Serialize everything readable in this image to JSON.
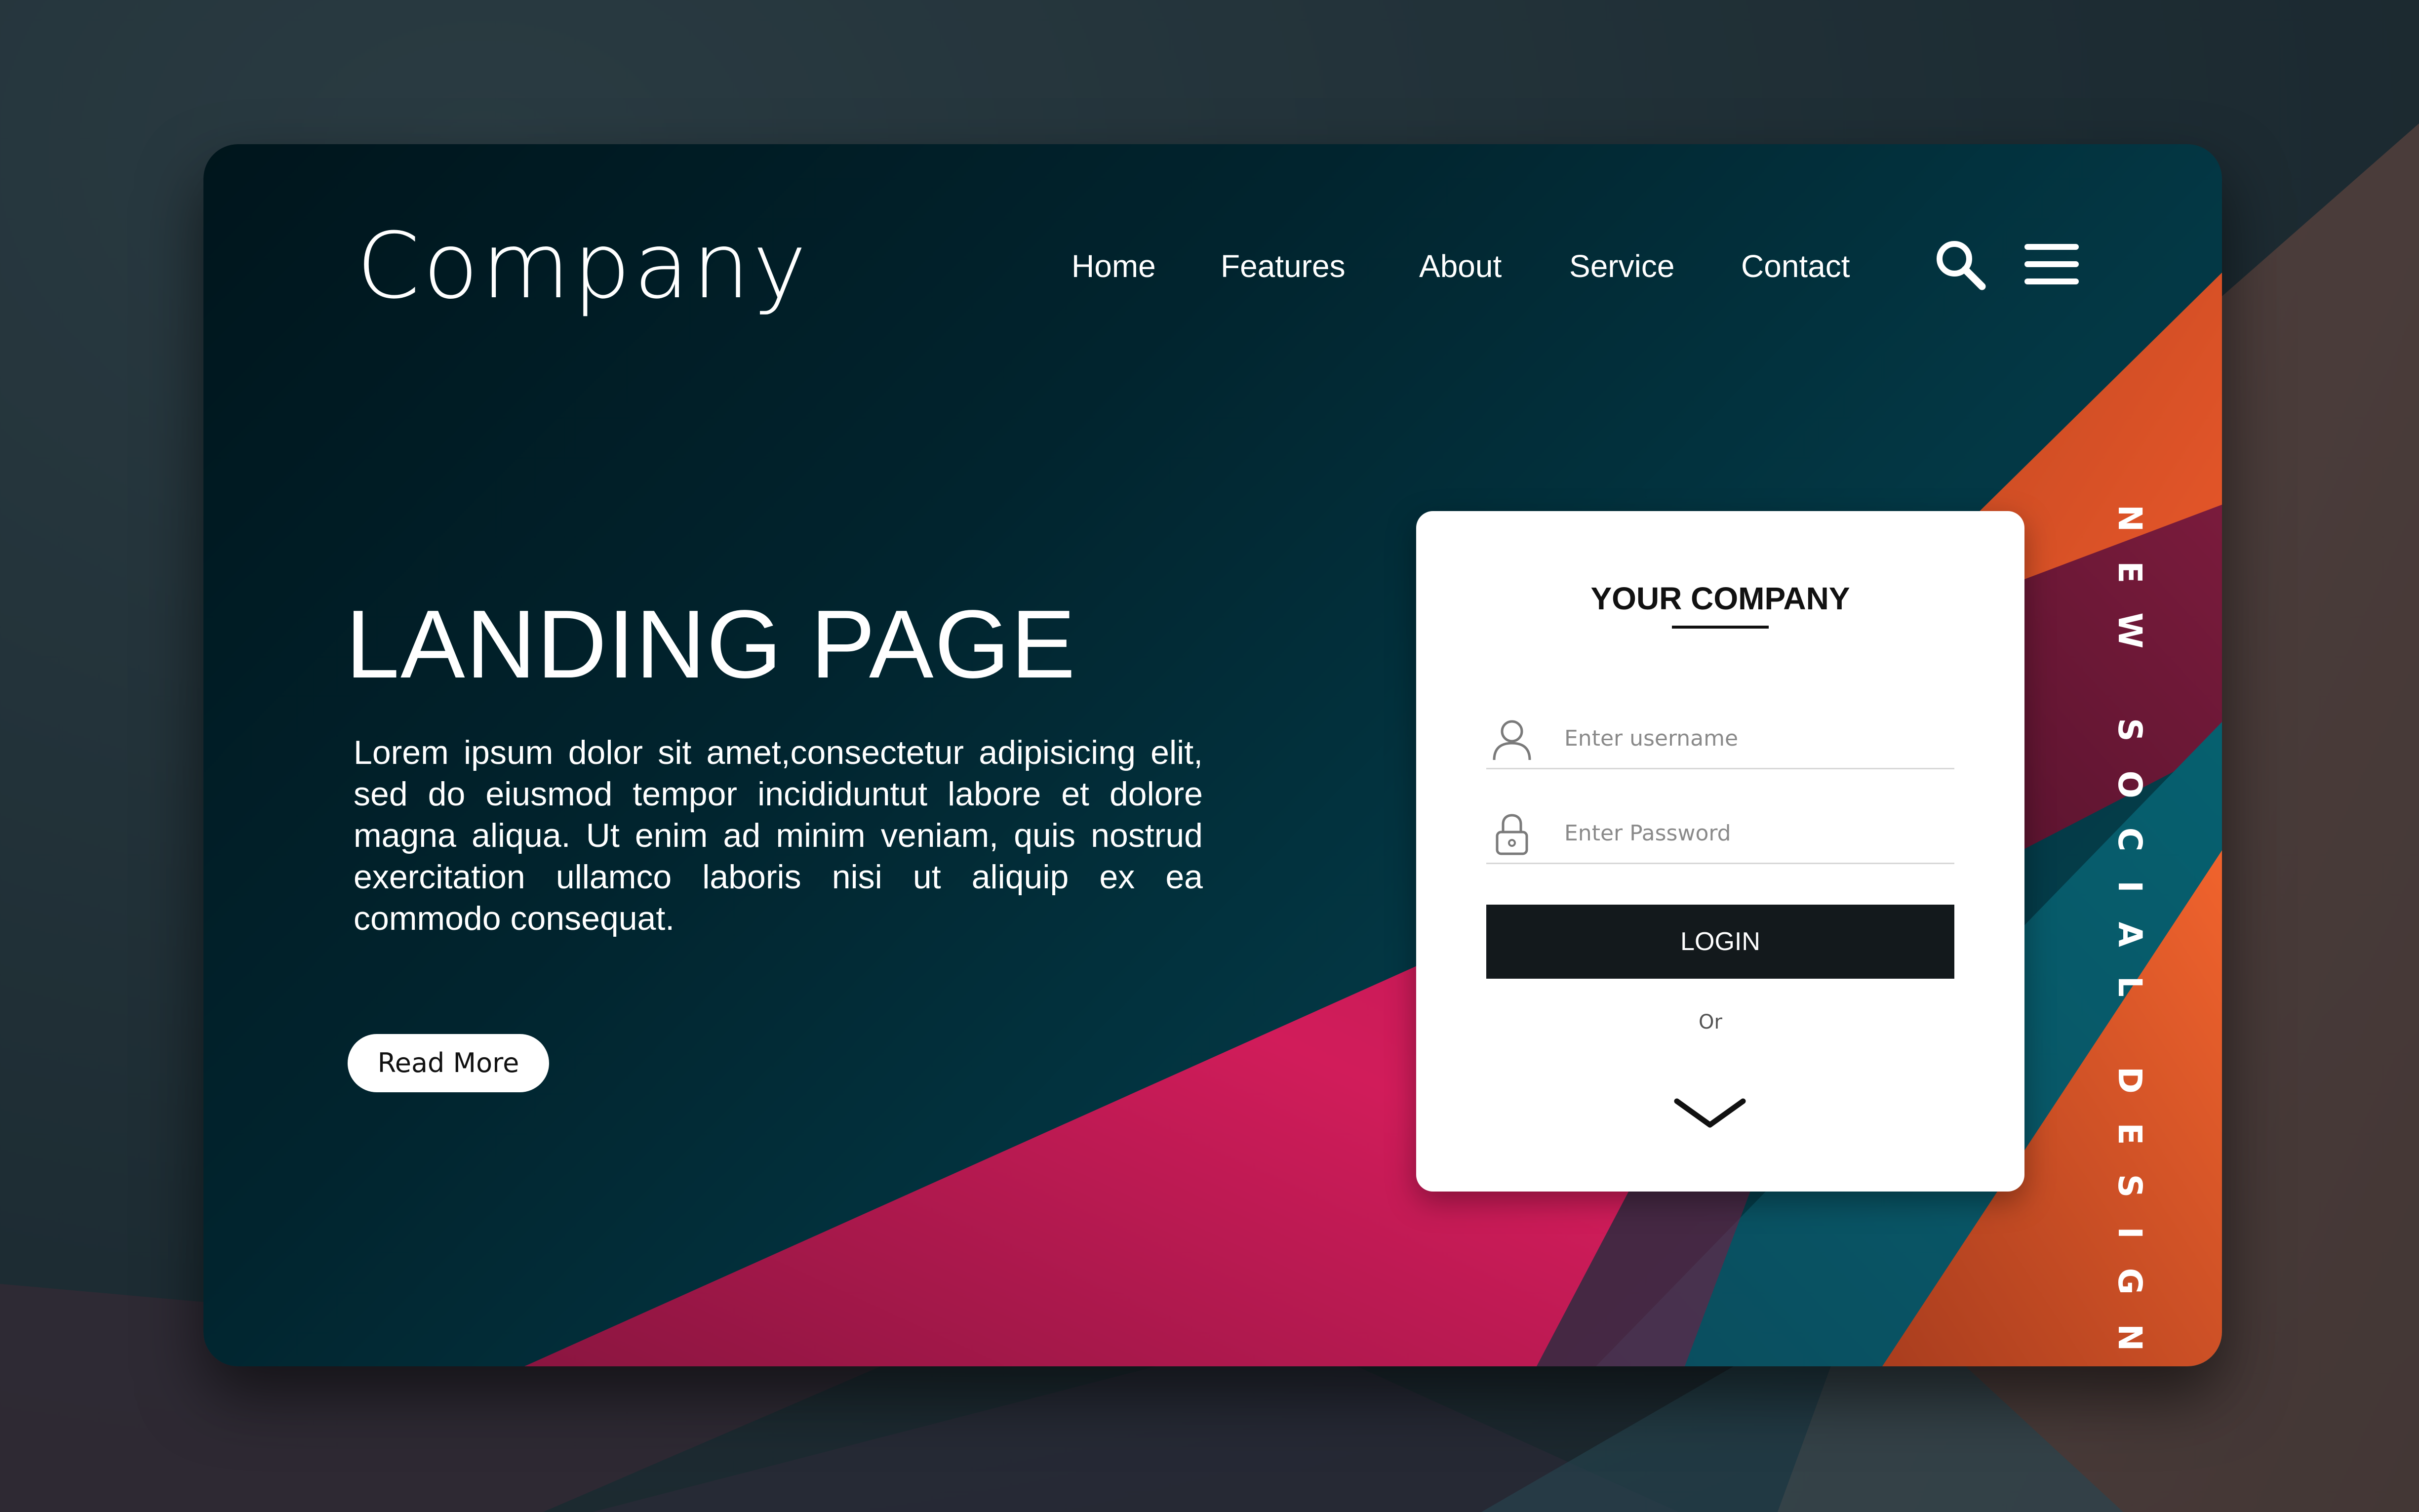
{
  "header": {
    "logo": "Company",
    "nav": [
      {
        "label": "Home"
      },
      {
        "label": "Features"
      },
      {
        "label": "About"
      },
      {
        "label": "Service"
      },
      {
        "label": "Contact"
      }
    ],
    "search_icon": "search-icon",
    "menu_icon": "hamburger-menu-icon"
  },
  "hero": {
    "title": "LANDING PAGE",
    "body": "Lorem ipsum dolor sit amet,consectetur adipisicing elit, sed do eiusmod tempor incididuntut labore et dolore magna aliqua. Ut enim ad minim veniam, quis nostrud exercitation ullamco laboris nisi ut aliquip ex ea commodo consequat.",
    "button_label": "Read More"
  },
  "login": {
    "title": "YOUR COMPANY",
    "username_placeholder": "Enter username",
    "password_placeholder": "Enter Password",
    "login_label": "LOGIN",
    "or_label": "Or",
    "user_icon": "user-icon",
    "lock_icon": "lock-icon",
    "chevron_icon": "chevron-down-icon"
  },
  "side_text": "NEW SOCIAL DESIGN",
  "colors": {
    "teal_dark": "#00151c",
    "teal": "#05404d",
    "magenta": "#d11c5a",
    "orange": "#e8572a",
    "burgundy": "#6d1836",
    "button_dark": "#13191c"
  }
}
